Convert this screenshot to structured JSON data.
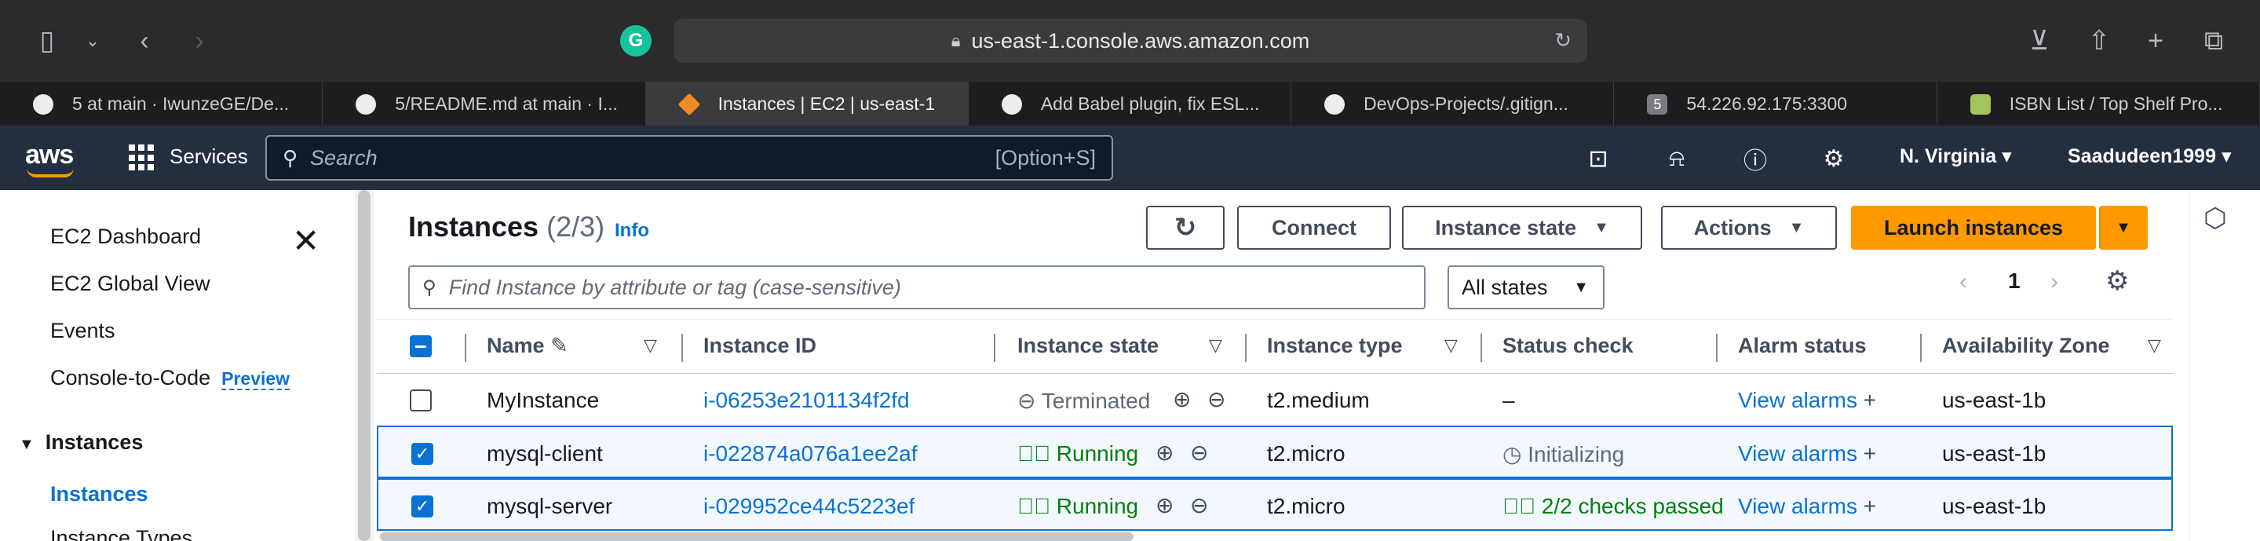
{
  "browser": {
    "url": "us-east-1.console.aws.amazon.com",
    "extension_badge": "G",
    "tabs": [
      {
        "label": "5 at main · IwunzeGE/De...",
        "favicon": "github-icon"
      },
      {
        "label": "5/README.md at main · I...",
        "favicon": "github-icon"
      },
      {
        "label": "Instances | EC2 | us-east-1",
        "favicon": "aws-icon",
        "active": true
      },
      {
        "label": "Add Babel plugin, fix ESL...",
        "favicon": "openai-icon"
      },
      {
        "label": "DevOps-Projects/.gitign...",
        "favicon": "github-icon"
      },
      {
        "label": "54.226.92.175:3300",
        "favicon": "number-icon",
        "favicon_text": "5"
      },
      {
        "label": "ISBN List / Top Shelf Pro...",
        "favicon": "book-icon"
      }
    ]
  },
  "header": {
    "logo": "aws",
    "services": "Services",
    "search_placeholder": "Search",
    "search_shortcut": "[Option+S]",
    "region": "N. Virginia",
    "user": "Saadudeen1999"
  },
  "sidebar": {
    "items": [
      {
        "label": "EC2 Dashboard"
      },
      {
        "label": "EC2 Global View"
      },
      {
        "label": "Events"
      },
      {
        "label": "Console-to-Code",
        "badge": "Preview"
      }
    ],
    "section": "Instances",
    "active_item": "Instances",
    "cut_item": "Instance Types"
  },
  "main": {
    "title": "Instances",
    "count": "(2/3)",
    "info": "Info",
    "buttons": {
      "connect": "Connect",
      "instance_state": "Instance state",
      "actions": "Actions",
      "launch": "Launch instances"
    },
    "filter_placeholder": "Find Instance by attribute or tag (case-sensitive)",
    "state_filter": "All states",
    "page": "1",
    "columns": [
      "Name",
      "Instance ID",
      "Instance state",
      "Instance type",
      "Status check",
      "Alarm status",
      "Availability Zone"
    ],
    "rows": [
      {
        "name": "MyInstance",
        "id": "i-06253e2101134f2fd",
        "state": "Terminated",
        "type": "t2.medium",
        "status": "–",
        "alarm": "View alarms",
        "zone": "us-east-1b",
        "selected": false
      },
      {
        "name": "mysql-client",
        "id": "i-022874a076a1ee2af",
        "state": "Running",
        "type": "t2.micro",
        "status": "Initializing",
        "alarm": "View alarms",
        "zone": "us-east-1b",
        "selected": true
      },
      {
        "name": "mysql-server",
        "id": "i-029952ce44c5223ef",
        "state": "Running",
        "type": "t2.micro",
        "status": "2/2 checks passed",
        "alarm": "View alarms",
        "zone": "us-east-1b",
        "selected": true
      }
    ]
  },
  "colors": {
    "aws_header": "#232f3e",
    "accent_orange": "#ff9900",
    "link_blue": "#0972d3",
    "running_green": "#037f0c"
  }
}
